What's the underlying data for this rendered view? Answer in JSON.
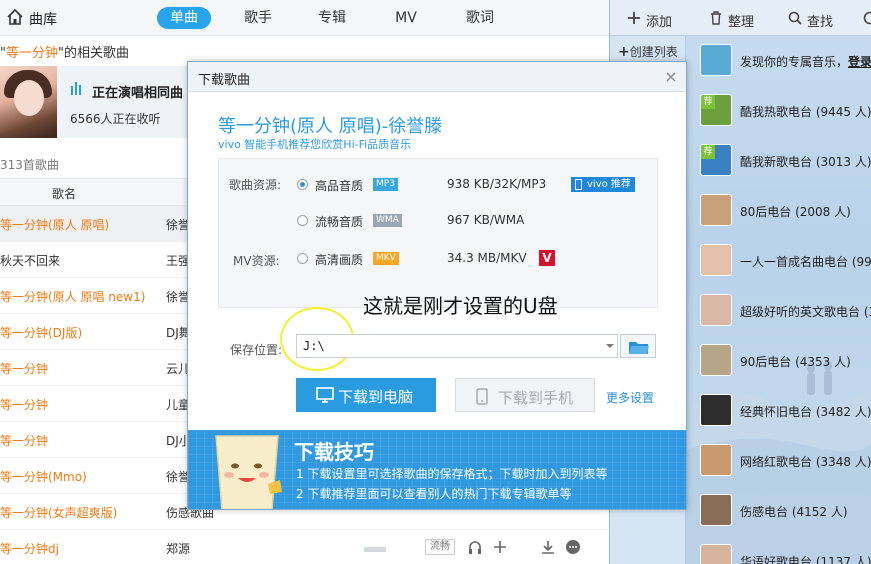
{
  "topbar": {
    "home_label": "曲库",
    "tabs": [
      {
        "label": "单曲",
        "active": true
      },
      {
        "label": "歌手",
        "active": false
      },
      {
        "label": "专辑",
        "active": false
      },
      {
        "label": "MV",
        "active": false
      },
      {
        "label": "歌词",
        "active": false
      }
    ]
  },
  "search": {
    "prefix": "\"",
    "keyword": "等一分钟",
    "suffix": "\"的相关歌曲"
  },
  "banner": {
    "playing": "正在演唱相同曲",
    "listeners": "6566人正在收听"
  },
  "list": {
    "count": "313首歌曲",
    "col_name": "歌名",
    "quality_label": "流畅",
    "rows": [
      {
        "song": "等一分钟(原人 原唱)",
        "artist": "徐誉",
        "keyword_highlight": true,
        "selected": true
      },
      {
        "song": "秋天不回来",
        "artist": "王强",
        "keyword_highlight": false,
        "selected": false
      },
      {
        "song": "等一分钟(原人 原唱 new1)",
        "artist": "徐誉",
        "keyword_highlight": true,
        "selected": false
      },
      {
        "song": "等一分钟(DJ版)",
        "artist": "DJ舞",
        "keyword_highlight": true,
        "selected": false
      },
      {
        "song": "等一分钟",
        "artist": "云儿",
        "keyword_highlight": true,
        "selected": false
      },
      {
        "song": "等一分钟",
        "artist": "儿童",
        "keyword_highlight": true,
        "selected": false
      },
      {
        "song": "等一分钟",
        "artist": "DJ小",
        "keyword_highlight": true,
        "selected": false
      },
      {
        "song": "等一分钟(Mmo)",
        "artist": "徐誉",
        "keyword_highlight": true,
        "selected": false
      },
      {
        "song": "等一分钟(女声超爽版)",
        "artist": "伤感歌曲",
        "keyword_highlight": true,
        "selected": false
      },
      {
        "song": "等一分钟dj",
        "artist": "郑源",
        "keyword_highlight": true,
        "selected": false
      }
    ]
  },
  "sidebar": {
    "tools": [
      {
        "label": "添加",
        "icon": "plus-icon"
      },
      {
        "label": "整理",
        "icon": "trash-icon"
      },
      {
        "label": "查找",
        "icon": "search-icon"
      }
    ],
    "create_list": "创建列表",
    "discover_text": "发现你的专属音乐，",
    "discover_link": "登录",
    "recommend_tag": "荐",
    "radios": [
      {
        "label": "酷我热歌电台 (9445 人)",
        "color": "#6b9f3d",
        "tag": true
      },
      {
        "label": "酷我新歌电台 (3013 人)",
        "color": "#3a7fc2",
        "tag": true
      },
      {
        "label": "80后电台 (2008 人)",
        "color": "#c8a17a",
        "tag": false
      },
      {
        "label": "一人一首成名曲电台 (99",
        "color": "#e2c1a8",
        "tag": false
      },
      {
        "label": "超级好听的英文歌电台 (3",
        "color": "#d9b9a6",
        "tag": false
      },
      {
        "label": "90后电台 (4353 人)",
        "color": "#b7a58a",
        "tag": false
      },
      {
        "label": "经典怀旧电台 (3482 人)",
        "color": "#2d2d2d",
        "tag": false
      },
      {
        "label": "网络红歌电台 (3348 人)",
        "color": "#c99a6e",
        "tag": false
      },
      {
        "label": "伤感电台 (4152 人)",
        "color": "#8a6d57",
        "tag": false
      },
      {
        "label": "华语好歌电台 (1137 人)",
        "color": "#d7b49c",
        "tag": false
      }
    ]
  },
  "dialog": {
    "title": "下载歌曲",
    "song_title": "等一分钟(原人 原唱)-徐誉滕",
    "ad_text": "vivo 智能手机推荐您欣赏Hi-Fi品质音乐",
    "song_source_label": "歌曲资源:",
    "mv_source_label": "MV资源:",
    "options": [
      {
        "quality": "高品音质",
        "format": "MP3",
        "format_color": "#3aa6e0",
        "size": "938 KB/32K/MP3",
        "checked": true
      },
      {
        "quality": "流畅音质",
        "format": "WMA",
        "format_color": "#9aa7b3",
        "size": "967 KB/WMA",
        "checked": false
      },
      {
        "quality": "高清画质",
        "format": "MKV",
        "format_color": "#f5a623",
        "size": "34.3 MB/MKV",
        "checked": false
      }
    ],
    "vivo_badge": "vivo 推荐",
    "v_badge": "V",
    "annotation": "这就是刚才设置的U盘",
    "save_label": "保存位置:",
    "save_path": "J:\\",
    "btn_pc": "下载到电脑",
    "btn_phone": "下载到手机",
    "more_settings": "更多设置",
    "tips_title": "下载技巧",
    "tips": [
      "1  下载设置里可选择歌曲的保存格式；下载时加入到列表等",
      "2  下载推荐里面可以查看别人的热门下载专辑歌单等"
    ]
  }
}
